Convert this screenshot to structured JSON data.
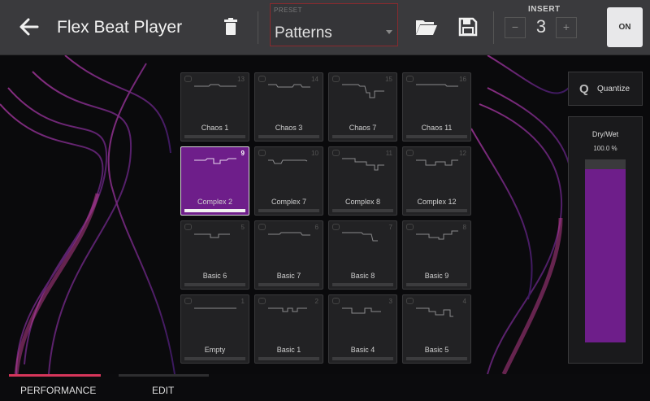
{
  "header": {
    "title": "Flex Beat Player",
    "preset_label": "PRESET",
    "preset_value": "Patterns",
    "insert_label": "INSERT",
    "insert_value": "3",
    "decrement": "−",
    "increment": "+",
    "on_label": "ON"
  },
  "pads": [
    {
      "name": "Chaos 1",
      "num": "13",
      "active": false
    },
    {
      "name": "Chaos 3",
      "num": "14",
      "active": false
    },
    {
      "name": "Chaos 7",
      "num": "15",
      "active": false
    },
    {
      "name": "Chaos 11",
      "num": "16",
      "active": false
    },
    {
      "name": "Complex 2",
      "num": "9",
      "active": true
    },
    {
      "name": "Complex 7",
      "num": "10",
      "active": false
    },
    {
      "name": "Complex 8",
      "num": "11",
      "active": false
    },
    {
      "name": "Complex 12",
      "num": "12",
      "active": false
    },
    {
      "name": "Basic 6",
      "num": "5",
      "active": false
    },
    {
      "name": "Basic 7",
      "num": "6",
      "active": false
    },
    {
      "name": "Basic 8",
      "num": "7",
      "active": false
    },
    {
      "name": "Basic 9",
      "num": "8",
      "active": false
    },
    {
      "name": "Empty",
      "num": "1",
      "active": false
    },
    {
      "name": "Basic 1",
      "num": "2",
      "active": false
    },
    {
      "name": "Basic 4",
      "num": "3",
      "active": false
    },
    {
      "name": "Basic 5",
      "num": "4",
      "active": false
    }
  ],
  "quantize": {
    "icon": "Q",
    "label": "Quantize"
  },
  "drywet": {
    "label": "Dry/Wet",
    "value_text": "100.0 %",
    "level": 1.0
  },
  "footer": {
    "tab_performance": "PERFORMANCE",
    "tab_edit": "EDIT"
  },
  "colors": {
    "accent": "#6e1e8a",
    "active_tab": "#d6365a",
    "header_bg": "#3a3a3d"
  }
}
